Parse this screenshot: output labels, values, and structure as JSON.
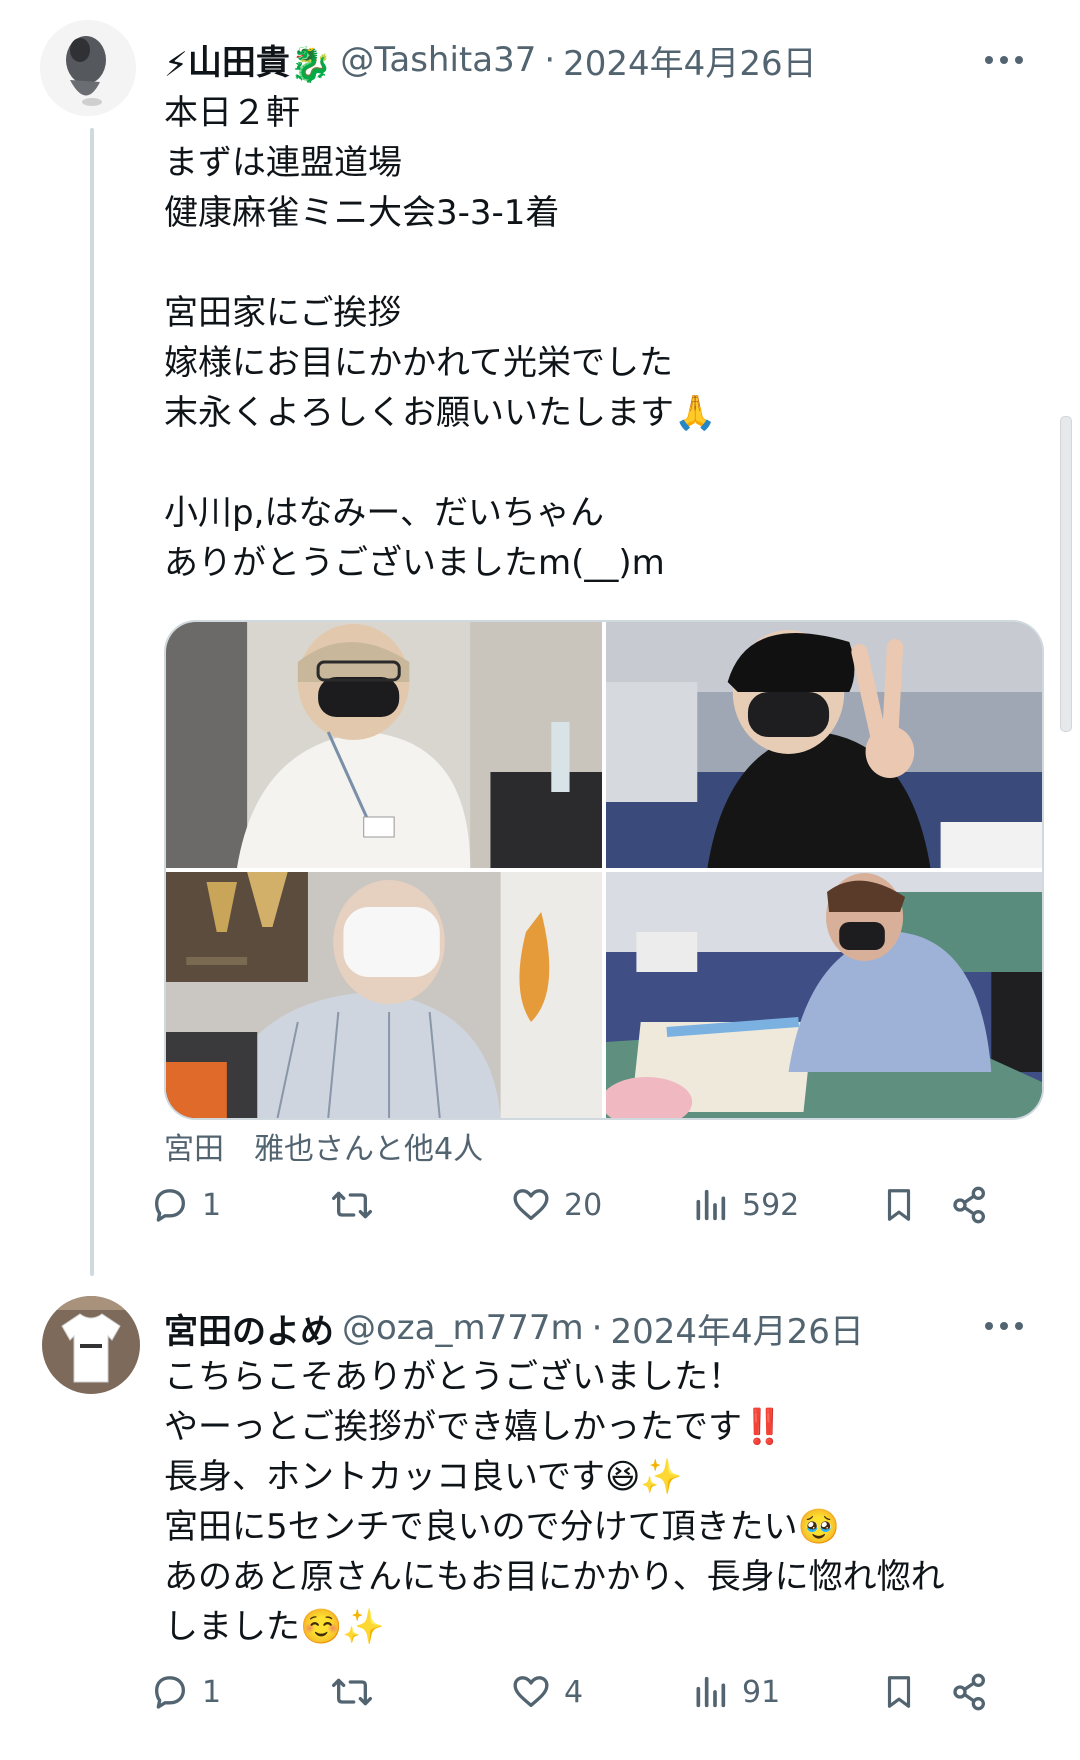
{
  "tweets": [
    {
      "author_emoji_pre": "⚡",
      "author_name": "山田貴",
      "author_emoji_post": "🐉",
      "handle": "@Tashita37",
      "separator": "·",
      "date": "2024年4月26日",
      "text": "本日２軒\nまずは連盟道場\n健康麻雀ミニ大会3-3-1着\n\n宮田家にご挨拶\n嫁様にお目にかかれて光栄でした\n末永くよろしくお願いいたします🙏\n\n小川p,はなみー、だいちゃん\nありがとうございましたm(__)m",
      "tagged": "宮田　雅也さんと他4人",
      "stats": {
        "replies": "1",
        "retweets": "",
        "likes": "20",
        "views": "592"
      }
    },
    {
      "author_name": "宮田のよめ",
      "handle": "@oza_m777m",
      "separator": "·",
      "date": "2024年4月26日",
      "text": "こちらこそありがとうございました！\nやーっとご挨拶ができ嬉しかったです‼️\n長身、ホントカッコ良いです😆✨\n宮田に5センチで良いので分けて頂きたい🥹\nあのあと原さんにもお目にかかり、長身に惚れ惚れ\nしました☺️✨",
      "stats": {
        "replies": "1",
        "retweets": "",
        "likes": "4",
        "views": "91"
      }
    }
  ],
  "icons": [
    "more-icon",
    "reply-icon",
    "retweet-icon",
    "like-icon",
    "views-icon",
    "bookmark-icon",
    "share-icon"
  ],
  "colors": {
    "text": "#0f1419",
    "secondary": "#536471",
    "border": "#cfd9de",
    "background": "#ffffff"
  }
}
